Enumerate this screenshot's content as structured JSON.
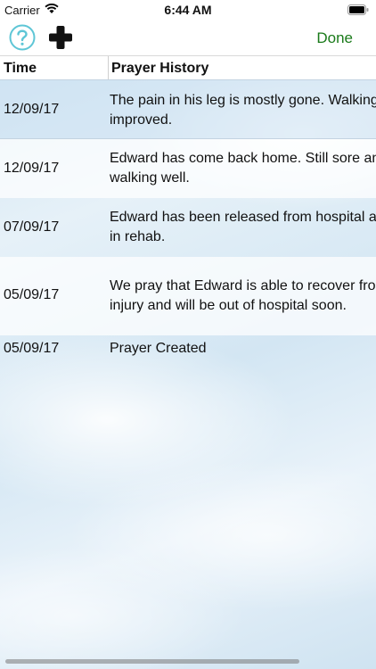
{
  "status_bar": {
    "carrier": "Carrier",
    "time": "6:44 AM"
  },
  "toolbar": {
    "help_icon": "question-circle-icon",
    "add_icon": "plus-icon",
    "done_label": "Done",
    "done_color": "#1a7a1a",
    "help_color": "#5ec6d6"
  },
  "table": {
    "headers": {
      "time": "Time",
      "history": "Prayer History"
    },
    "rows": [
      {
        "time": "12/09/17",
        "line1": "The pain in his leg is mostly gone.  Walking has",
        "line2": "improved."
      },
      {
        "time": "12/09/17",
        "line1": "Edward has come back home.  Still sore and not",
        "line2": "walking well."
      },
      {
        "time": "07/09/17",
        "line1": "Edward has been released from hospital and is",
        "line2": "in rehab."
      },
      {
        "time": "05/09/17",
        "line1": "We pray that Edward is able to recover from his",
        "line2": "injury and will be out of hospital soon."
      },
      {
        "time": "05/09/17",
        "line1": "Prayer Created",
        "line2": ""
      }
    ]
  }
}
